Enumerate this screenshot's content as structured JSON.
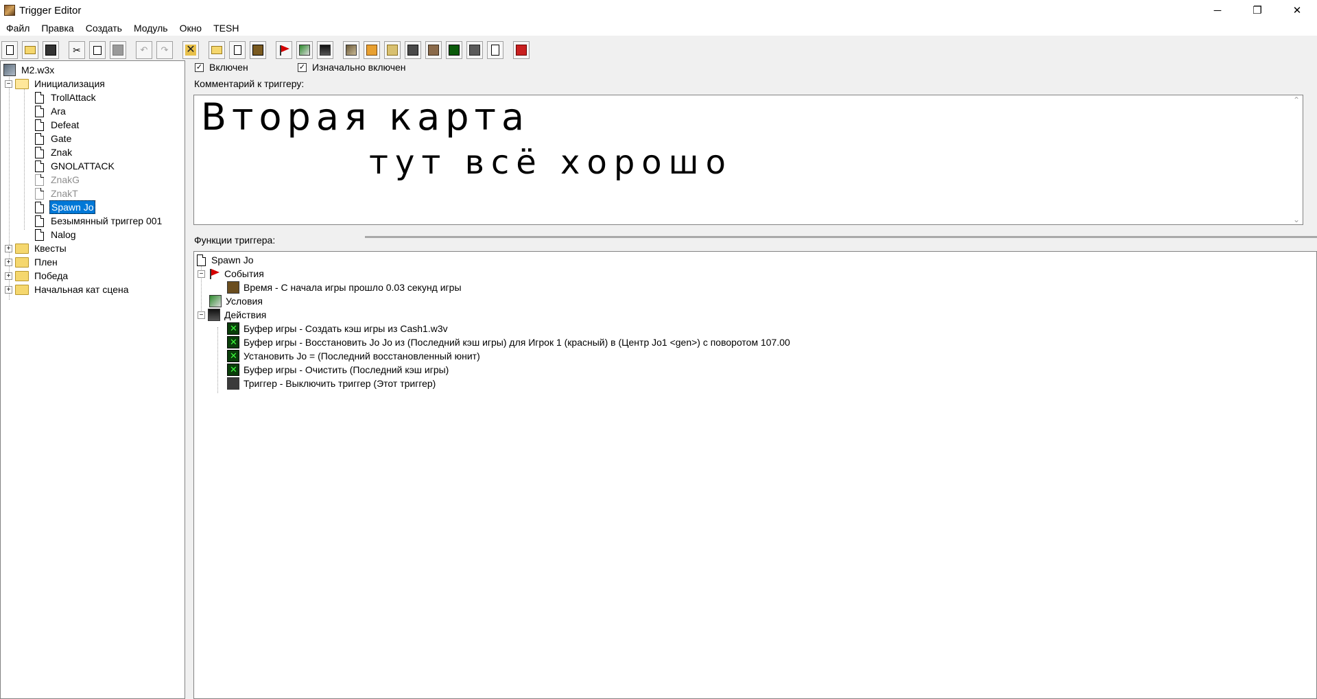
{
  "window": {
    "title": "Trigger Editor",
    "controls": {
      "minimize": "─",
      "maximize": "❐",
      "close": "✕"
    }
  },
  "menu": [
    "Файл",
    "Правка",
    "Создать",
    "Модуль",
    "Окно",
    "TESH"
  ],
  "tree": {
    "map": "M2.w3x",
    "folders": [
      {
        "label": "Инициализация",
        "expanded": true,
        "items": [
          {
            "label": "TrollAttack",
            "disabled": false,
            "selected": false
          },
          {
            "label": "Ara",
            "disabled": false,
            "selected": false
          },
          {
            "label": "Defeat",
            "disabled": false,
            "selected": false
          },
          {
            "label": "Gate",
            "disabled": false,
            "selected": false
          },
          {
            "label": "Znak",
            "disabled": false,
            "selected": false
          },
          {
            "label": "GNOLATTACK",
            "disabled": false,
            "selected": false
          },
          {
            "label": "ZnakG",
            "disabled": true,
            "selected": false
          },
          {
            "label": "ZnakT",
            "disabled": true,
            "selected": false
          },
          {
            "label": "Spawn Jo",
            "disabled": false,
            "selected": true
          },
          {
            "label": "Безымянный триггер 001",
            "disabled": false,
            "selected": false
          },
          {
            "label": "Nalog",
            "disabled": false,
            "selected": false
          }
        ]
      },
      {
        "label": "Квесты",
        "expanded": false
      },
      {
        "label": "Плен",
        "expanded": false
      },
      {
        "label": "Победа",
        "expanded": false
      },
      {
        "label": "Начальная кат сцена",
        "expanded": false
      }
    ]
  },
  "trigger": {
    "enabled_label": "Включен",
    "initially_enabled_label": "Изначально включен",
    "comment_label": "Комментарий к триггеру:",
    "comment_lines": [
      "Вторая карта",
      "тут всё хорошо"
    ],
    "functions_label": "Функции триггера:",
    "name": "Spawn Jo",
    "events_label": "События",
    "events": [
      "Время - С начала игры прошло 0.03 секунд игры"
    ],
    "conditions_label": "Условия",
    "actions_label": "Действия",
    "actions": [
      "Буфер игры - Создать кэш игры из Cash1.w3v",
      "Буфер игры - Восстановить Jo Jo из (Последний кэш игры) для Игрок 1 (красный) в (Центр Jo1 <gen>) с поворотом 107.00",
      "Установить Jo = (Последний восстановленный юнит)",
      "Буфер игры - Очистить (Последний кэш игры)",
      "Триггер - Выключить триггер (Этот триггер)"
    ]
  }
}
